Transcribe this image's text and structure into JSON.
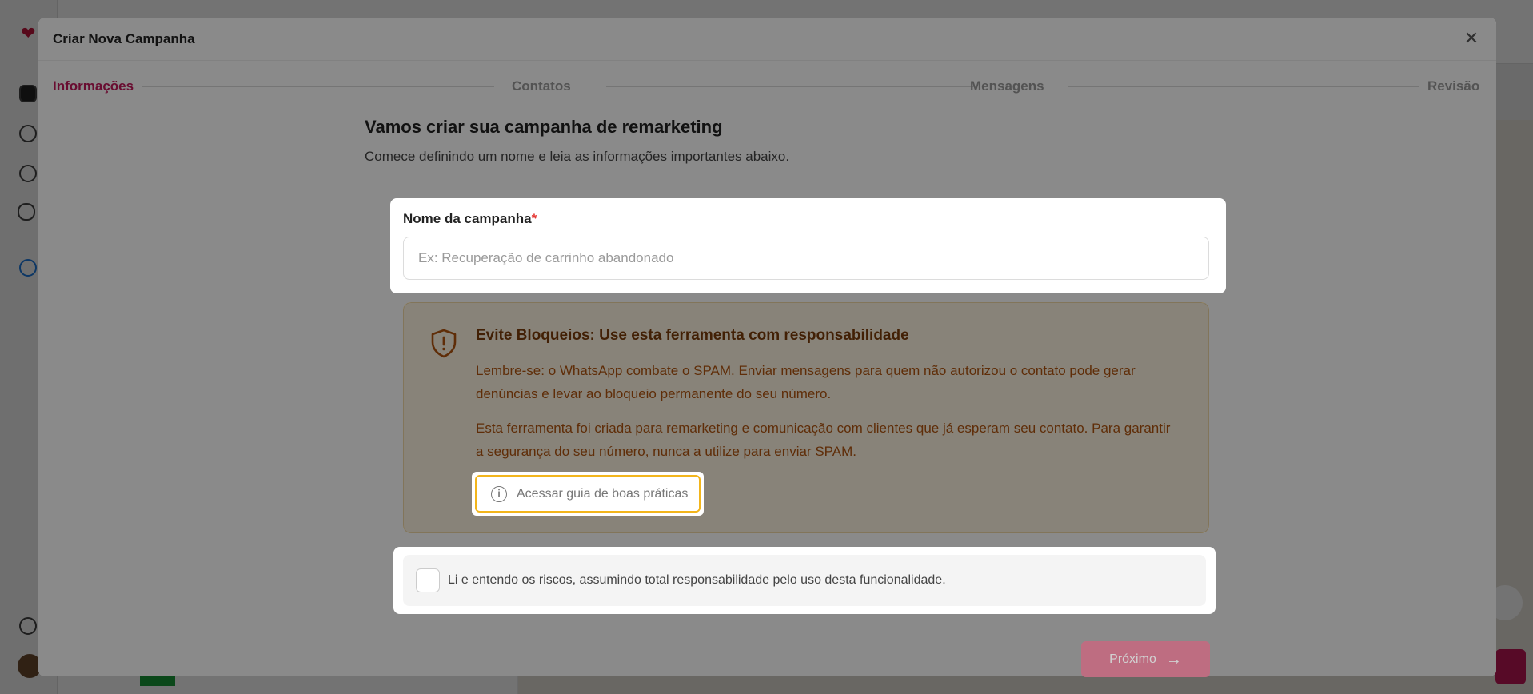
{
  "modal": {
    "title": "Criar Nova Campanha",
    "close_icon": "close-icon"
  },
  "steps": [
    {
      "label": "Informações",
      "active": true
    },
    {
      "label": "Contatos",
      "active": false
    },
    {
      "label": "Mensagens",
      "active": false
    },
    {
      "label": "Revisão",
      "active": false
    }
  ],
  "intro": {
    "title": "Vamos criar sua campanha de remarketing",
    "subtitle": "Comece definindo um nome e leia as informações importantes abaixo."
  },
  "campaign_name": {
    "label": "Nome da campanha",
    "required_mark": "*",
    "value": "",
    "placeholder": "Ex: Recuperação de carrinho abandonado"
  },
  "warning": {
    "icon": "shield-alert-icon",
    "title": "Evite Bloqueios: Use esta ferramenta com responsabilidade",
    "paragraph1": "Lembre-se: o WhatsApp combate o SPAM. Enviar mensagens para quem não autorizou o contato pode gerar denúncias e levar ao bloqueio permanente do seu número.",
    "paragraph2": "Esta ferramenta foi criada para remarketing e comunicação com clientes que já esperam seu contato. Para garantir a segurança do seu número, nunca a utilize para enviar SPAM.",
    "guide_button": "Acessar guia de boas práticas",
    "guide_icon": "info-icon"
  },
  "agreement": {
    "checked": false,
    "label": "Li e entendo os riscos, assumindo total responsabilidade pelo uso desta funcionalidade."
  },
  "footer": {
    "next_label": "Próximo",
    "next_icon": "arrow-right-icon"
  },
  "colors": {
    "accent": "#c2185b",
    "warning_bg": "#fbf3df",
    "warning_text": "#b0530f",
    "highlight_border": "#f2b51c",
    "next_button": "#e8859e"
  }
}
